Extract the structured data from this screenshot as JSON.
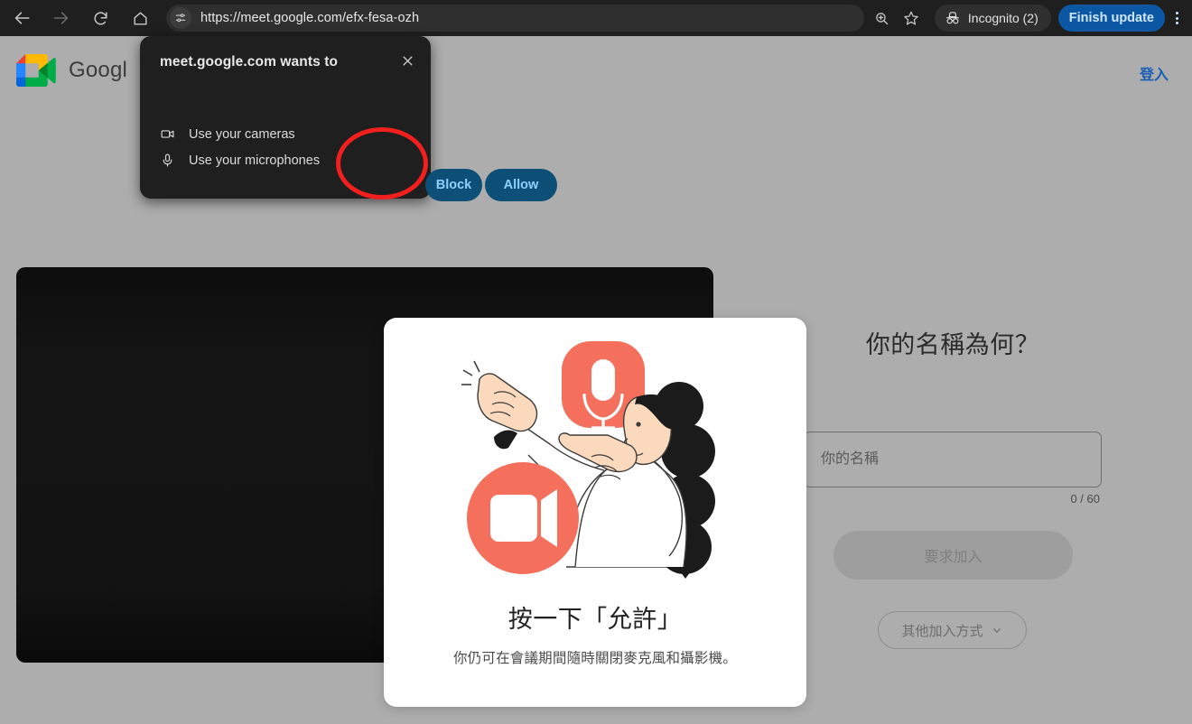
{
  "browser": {
    "back_icon": "arrow-left-icon",
    "forward_icon": "arrow-right-icon",
    "reload_icon": "reload-icon",
    "home_icon": "home-icon",
    "site_info_icon": "tune-icon",
    "url": "https://meet.google.com/efx-fesa-ozh",
    "zoom_icon": "zoom-in-icon",
    "bookmark_icon": "star-icon",
    "incognito_icon": "incognito-icon",
    "incognito_label": "Incognito (2)",
    "finish_update_label": "Finish update",
    "menu_icon": "three-dot-menu-icon",
    "accent_blue": "#0b57a4"
  },
  "permission_dialog": {
    "title": "meet.google.com wants to",
    "close_icon": "close-icon",
    "permissions": [
      {
        "icon": "camera-icon",
        "label": "Use your cameras"
      },
      {
        "icon": "microphone-icon",
        "label": "Use your microphones"
      }
    ],
    "block_label": "Block",
    "allow_label": "Allow",
    "button_fill": "#0d4f77",
    "button_text_color": "#8fd0ff",
    "highlight_color": "#f21f1f"
  },
  "meet_page": {
    "logo_icon": "google-meet-logo",
    "wordmark": "Googl",
    "signin_label": "登入",
    "signin_color": "#1a5fb4",
    "background_color": "#adadad",
    "video_preview_name": "camera-preview"
  },
  "join_panel": {
    "heading": "你的名稱為何？",
    "name_placeholder": "你的名稱",
    "name_value": "",
    "char_counter": "0 / 60",
    "ask_to_join_label": "要求加入",
    "other_join_label": "其他加入方式",
    "other_join_chevron_icon": "chevron-down-icon"
  },
  "modal": {
    "illustration_name": "allow-permissions-illustration",
    "illustration_colors": {
      "coral": "#f4705c",
      "skin": "#fbd9bd",
      "black": "#1b1b1b",
      "outline": "#3c3c3c"
    },
    "title": "按一下「允許」",
    "subtitle": "你仍可在會議期間隨時關閉麥克風和攝影機。"
  }
}
